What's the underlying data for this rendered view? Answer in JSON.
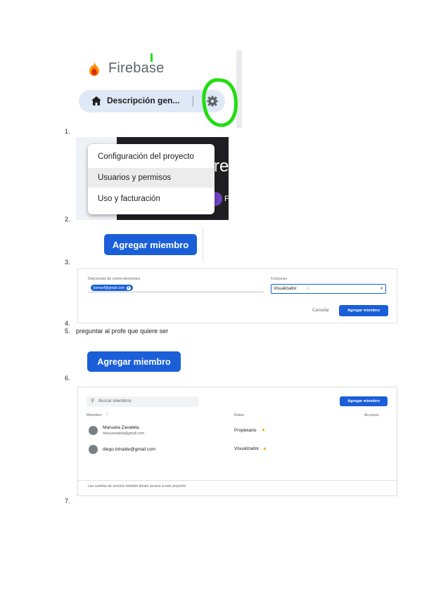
{
  "steps": {
    "s1": "1.",
    "s2": "2.",
    "s3": "3.",
    "s4": "4.",
    "s5": "5.",
    "s6": "6.",
    "s7": "7."
  },
  "note5": "preguntar al profe que quiere ser",
  "panel1": {
    "brand": "Firebase",
    "nav_label": "Descripción gen...",
    "home_icon": "home-icon",
    "settings_icon": "gear-icon",
    "highlight_color": "#22dd11"
  },
  "panel2": {
    "menu_items": [
      "Configuración del proyecto",
      "Usuarios y permisos",
      "Uso y facturación"
    ],
    "bg_letter": "re",
    "bg_letter2": "F"
  },
  "panel3": {
    "button_label": "Agregar miembro"
  },
  "panel4": {
    "email_label": "Direcciones de correo electrónico",
    "email_chip": "jtomasf@gmail.com",
    "role_label": "Funciones",
    "role_value": "Visualizador",
    "cancel_label": "Cancelar",
    "add_label": "Agregar miembro"
  },
  "panel6": {
    "button_label": "Agregar miembro"
  },
  "panel7": {
    "search_placeholder": "Buscar miembros",
    "add_label": "Agregar miembro",
    "col_member": "Miembro",
    "col_role": "Roles",
    "col_access": "Accesos",
    "rows": [
      {
        "name": "Manuela Zavaleta",
        "email": "manuzavaleta@gmail.com",
        "role": "Propietario"
      },
      {
        "name": "",
        "email": "diego.tohalde@gmail.com",
        "role": "Visualizador"
      }
    ],
    "footer": "Las cuentas de servicio también tienen acceso a este proyecto"
  },
  "colors": {
    "primary_blue": "#1a5fd8",
    "firebase_orange": "#ff8f00"
  }
}
